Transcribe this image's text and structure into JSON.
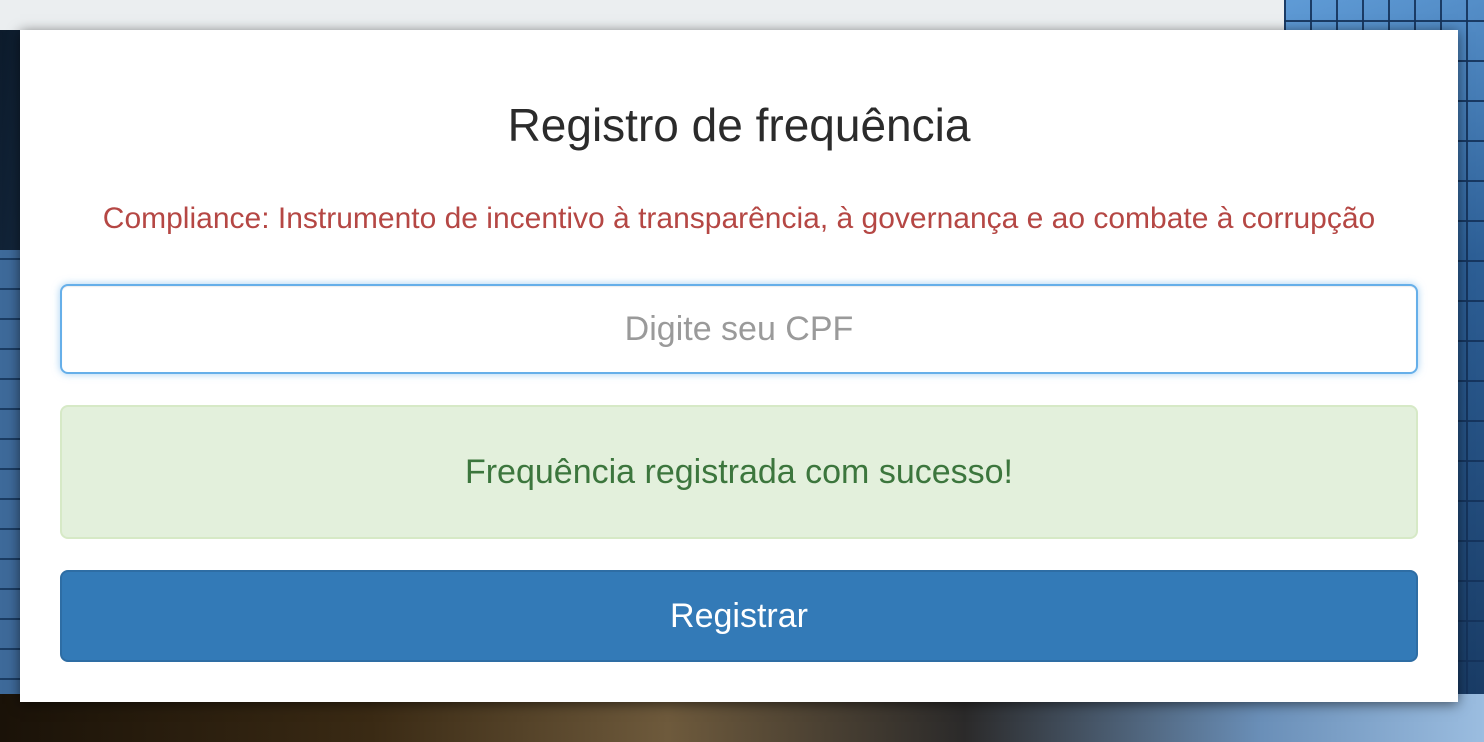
{
  "page": {
    "title": "Registro de frequência",
    "subtitle": "Compliance: Instrumento de incentivo à transparência, à governança e ao combate à corrupção"
  },
  "form": {
    "cpf_input": {
      "value": "",
      "placeholder": "Digite seu CPF"
    },
    "success_message": "Frequência registrada com sucesso!",
    "submit_label": "Registrar"
  },
  "colors": {
    "title": "#2b2b2b",
    "subtitle": "#b54744",
    "input_focus_border": "#66afe9",
    "alert_background": "#e3f0dc",
    "alert_text": "#3c763d",
    "button_background": "#337ab7",
    "button_text": "#ffffff"
  }
}
